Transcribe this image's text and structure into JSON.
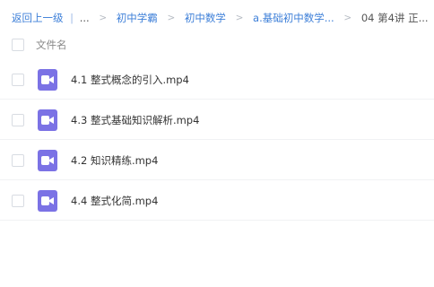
{
  "breadcrumb": {
    "back_label": "返回上一级",
    "bar": "|",
    "ellipsis": "...",
    "separator": ">",
    "items": [
      {
        "label": "初中学霸"
      },
      {
        "label": "初中数学"
      },
      {
        "label": "a.基础初中数学..."
      }
    ],
    "current": "04 第4讲 正..."
  },
  "list_header": {
    "name_column": "文件名"
  },
  "files": [
    {
      "name": "4.1 整式概念的引入.mp4",
      "icon": "video-file-icon"
    },
    {
      "name": "4.3 整式基础知识解析.mp4",
      "icon": "video-file-icon"
    },
    {
      "name": "4.2 知识精练.mp4",
      "icon": "video-file-icon"
    },
    {
      "name": "4.4 整式化简.mp4",
      "icon": "video-file-icon"
    }
  ],
  "colors": {
    "link": "#3d7fd8",
    "video_icon": "#7b72e5"
  }
}
